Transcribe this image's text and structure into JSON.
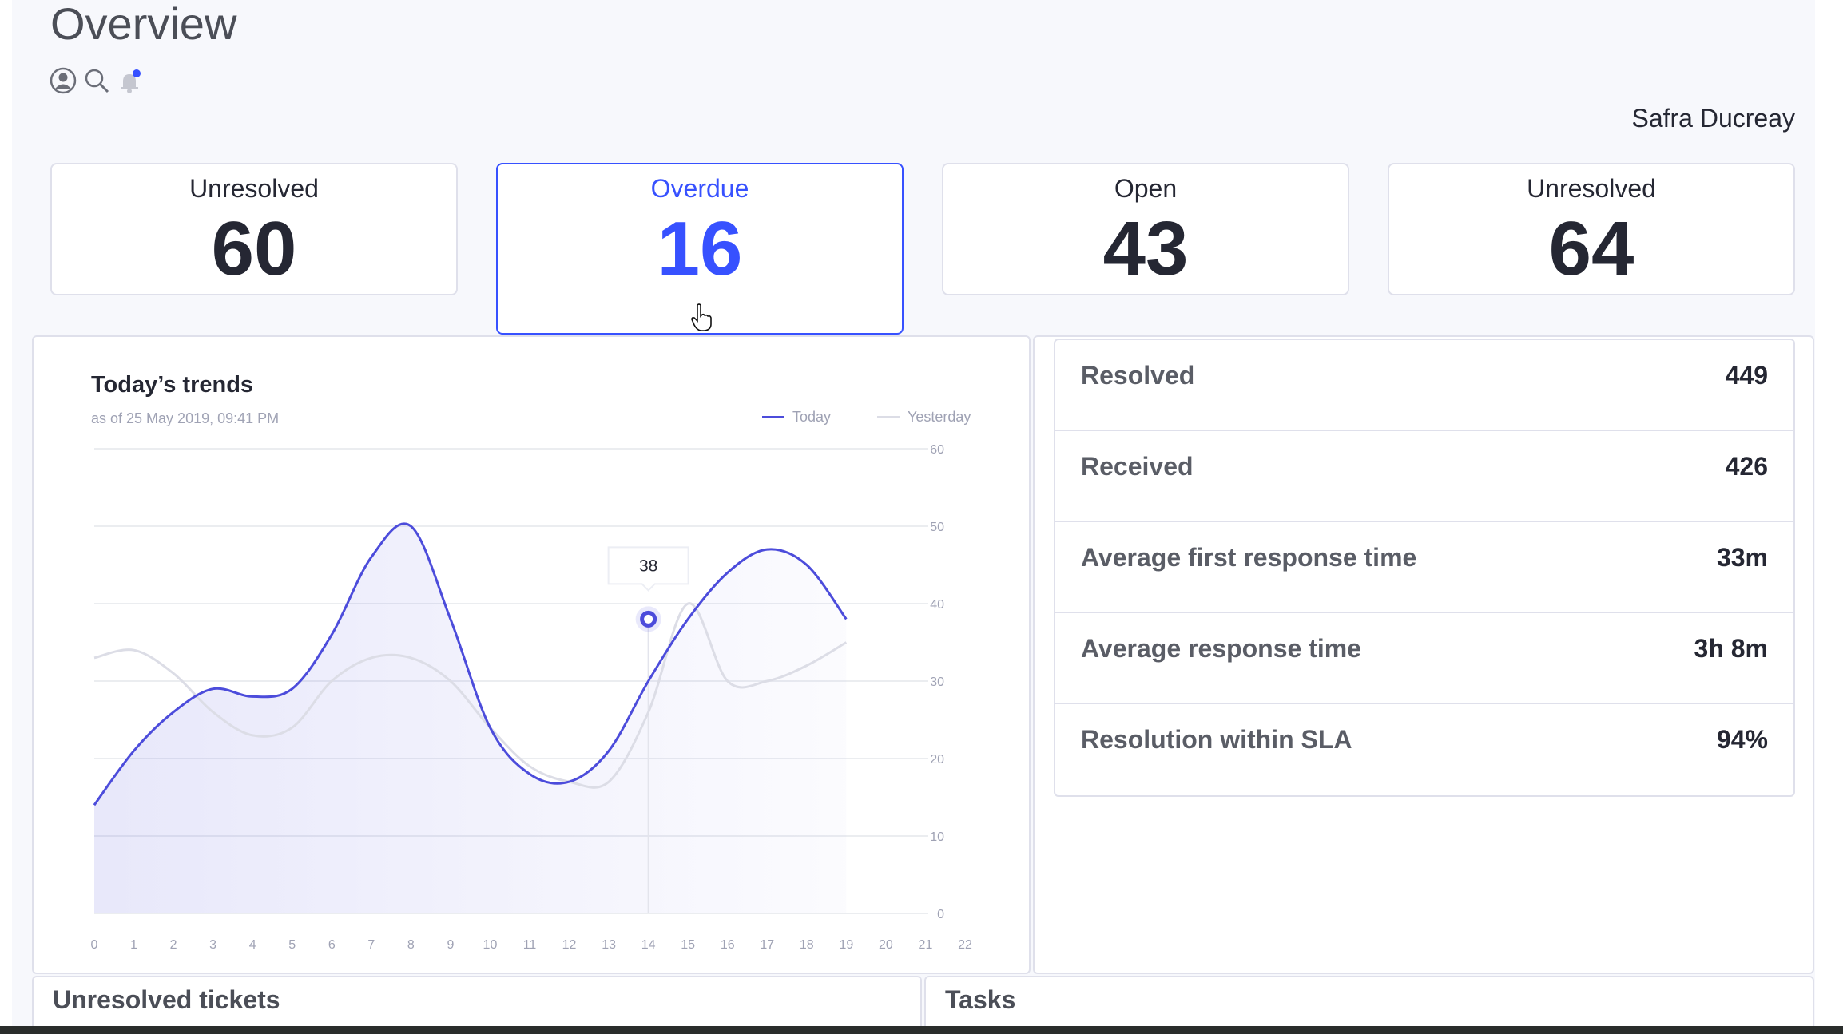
{
  "header": {
    "title": "Overview",
    "user_name": "Safra Ducreay",
    "icons": [
      "user-icon",
      "search-icon",
      "bell-icon"
    ]
  },
  "kpis": [
    {
      "label": "Unresolved",
      "value": "60"
    },
    {
      "label": "Overdue",
      "value": "16"
    },
    {
      "label": "Open",
      "value": "43"
    },
    {
      "label": "Unresolved",
      "value": "64"
    }
  ],
  "colors": {
    "accent": "#3751ff",
    "today": "#4c4cdb",
    "yesterday": "#dcdde6",
    "text": "#252733",
    "muted": "#9fa2b4"
  },
  "trends": {
    "title": "Today’s trends",
    "subtitle": "as of 25 May 2019, 09:41 PM",
    "legend_today": "Today",
    "legend_yesterday": "Yesterday",
    "tooltip": "38"
  },
  "chart_data": {
    "type": "line",
    "x": [
      0,
      1,
      2,
      3,
      4,
      5,
      6,
      7,
      8,
      9,
      10,
      11,
      12,
      13,
      14,
      15,
      16,
      17,
      18,
      19,
      20,
      21,
      22
    ],
    "ylim": [
      0,
      60
    ],
    "y_ticks": [
      "0",
      "10",
      "20",
      "30",
      "40",
      "50",
      "60"
    ],
    "x_ticks": [
      "0",
      "1",
      "2",
      "3",
      "4",
      "5",
      "6",
      "7",
      "8",
      "9",
      "10",
      "11",
      "12",
      "13",
      "14",
      "15",
      "16",
      "17",
      "18",
      "19",
      "20",
      "21",
      "22"
    ],
    "series": [
      {
        "name": "Today",
        "x": [
          0,
          1,
          2,
          3,
          4,
          5,
          6,
          7,
          8,
          9,
          10,
          11,
          12,
          13,
          14,
          15,
          16,
          17,
          18,
          19
        ],
        "values": [
          14,
          21,
          26,
          29,
          28,
          29,
          36,
          46,
          50,
          38,
          24,
          18,
          17,
          21,
          30,
          38,
          44,
          47,
          45,
          38
        ]
      },
      {
        "name": "Yesterday",
        "x": [
          0,
          1,
          2,
          3,
          4,
          5,
          6,
          7,
          8,
          9,
          10,
          11,
          12,
          13,
          14,
          15,
          16,
          17,
          18,
          19
        ],
        "values": [
          33,
          34,
          31,
          26,
          23,
          24,
          30,
          33,
          33,
          30,
          24,
          19,
          17,
          17,
          26,
          40,
          30,
          30,
          32,
          35
        ]
      }
    ],
    "highlight": {
      "x": 14,
      "value": 38
    },
    "grid": true,
    "legend": "top-right"
  },
  "stats": [
    {
      "label": "Resolved",
      "value": "449"
    },
    {
      "label": "Received",
      "value": "426"
    },
    {
      "label": "Average first response time",
      "value": "33m"
    },
    {
      "label": "Average response time",
      "value": "3h 8m"
    },
    {
      "label": "Resolution within SLA",
      "value": "94%"
    }
  ],
  "bottom": {
    "unresolved_title": "Unresolved tickets",
    "tasks_title": "Tasks"
  }
}
